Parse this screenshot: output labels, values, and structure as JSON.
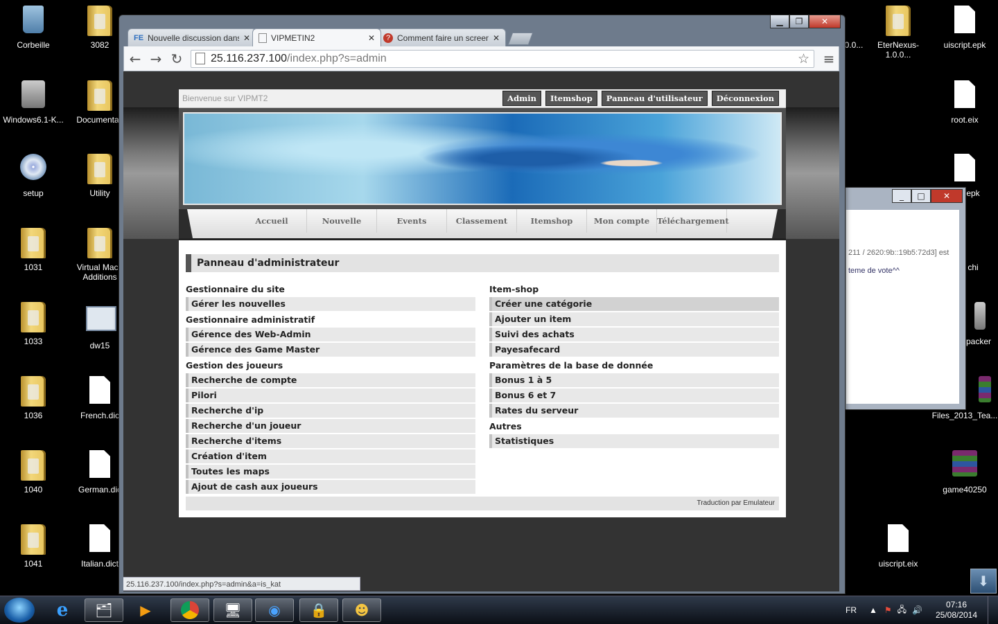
{
  "desktop": {
    "icons": [
      {
        "label": "Corbeille"
      },
      {
        "label": "3082"
      },
      {
        "label": "Windows6.1-K..."
      },
      {
        "label": "Documentati"
      },
      {
        "label": "setup"
      },
      {
        "label": "Utility"
      },
      {
        "label": "1031"
      },
      {
        "label": "Virtual Mach Additions"
      },
      {
        "label": "1033"
      },
      {
        "label": "dw15"
      },
      {
        "label": "1036"
      },
      {
        "label": "French.dic"
      },
      {
        "label": "1040"
      },
      {
        "label": "German.dic"
      },
      {
        "label": "1041"
      },
      {
        "label": "Italian.dict"
      },
      {
        "label": "EterNexus-1.0.0..."
      },
      {
        "label": "uiscript.epk"
      },
      {
        "label": "root.eix"
      },
      {
        "label": "game40250"
      },
      {
        "label": "uiscript.eix"
      },
      {
        "label": "Files_2013_Tea..."
      }
    ],
    "partial_labels": {
      "a": "0.0...",
      "b": "epk",
      "c": "chi",
      "d": "packer"
    }
  },
  "browser": {
    "tabs": [
      {
        "title": "Nouvelle discussion dans",
        "icon": "FE"
      },
      {
        "title": "VIPMETIN2",
        "icon": ""
      },
      {
        "title": "Comment faire un screens",
        "icon": "?"
      }
    ],
    "url_host": "25.116.237.100",
    "url_path": "/index.php?s=admin",
    "status_url": "25.116.237.100/index.php?s=admin&a=is_kat"
  },
  "site": {
    "welcome": "Bienvenue sur VIPMT2",
    "top_buttons": [
      "Admin",
      "Itemshop",
      "Panneau d'utilisateur",
      "Déconnexion"
    ],
    "nav": [
      "Accueil",
      "Nouvelle",
      "Events",
      "Classement",
      "Itemshop",
      "Mon compte",
      "Téléchargement"
    ],
    "panel_title": "Panneau d'administrateur",
    "left": {
      "sec1": "Gestionnaire du site",
      "sec1_items": [
        "Gérer les nouvelles"
      ],
      "sec2": "Gestionnaire administratif",
      "sec2_items": [
        "Gérence des Web-Admin",
        "Gérence des Game Master"
      ],
      "sec3": "Gestion des joueurs",
      "sec3_items": [
        "Recherche de compte",
        "Pilori",
        "Recherche d'ip",
        "Recherche d'un joueur",
        "Recherche d'items",
        "Création d'item",
        "Toutes les maps",
        "Ajout de cash aux joueurs"
      ]
    },
    "right": {
      "sec1": "Item-shop",
      "sec1_items": [
        "Créer une catégorie",
        "Ajouter un item",
        "Suivi des achats",
        "Payesafecard"
      ],
      "sec2": "Paramètres de la base de donnée",
      "sec2_items": [
        "Bonus 1 à 5",
        "Bonus 6 et 7",
        "Rates du serveur"
      ],
      "sec3": "Autres",
      "sec3_items": [
        "Statistiques"
      ]
    },
    "footer": "Traduction par Emulateur"
  },
  "background_window": {
    "line1": "211 / 2620:9b::19b5:72d3] est",
    "line2": "teme de vote^^"
  },
  "taskbar": {
    "lang": "FR",
    "time": "07:16",
    "date": "25/08/2014"
  }
}
